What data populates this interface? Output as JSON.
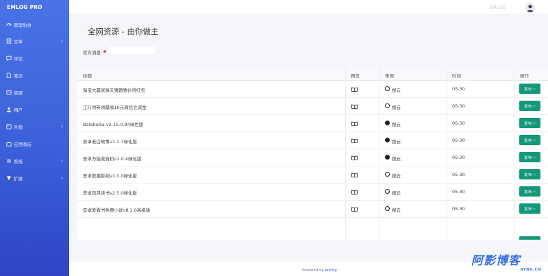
{
  "sidebar": {
    "brand": "EMLOG PRO",
    "items": [
      {
        "label": "管理后台",
        "icon": "dashboard-icon",
        "chevron": false
      },
      {
        "label": "文章",
        "icon": "article-icon",
        "chevron": true
      },
      {
        "label": "评论",
        "icon": "comment-icon",
        "chevron": false
      },
      {
        "label": "笔记",
        "icon": "note-icon",
        "chevron": false
      },
      {
        "label": "资源",
        "icon": "resource-icon",
        "chevron": false
      },
      {
        "label": "用户",
        "icon": "user-icon",
        "chevron": false
      },
      {
        "label": "外观",
        "icon": "appearance-icon",
        "chevron": true
      },
      {
        "label": "应用商店",
        "icon": "store-icon",
        "chevron": false
      },
      {
        "label": "系统",
        "icon": "gear-icon",
        "chevron": true
      },
      {
        "label": "扩展",
        "icon": "plugin-icon",
        "chevron": true
      }
    ]
  },
  "topbar": {
    "brand": "EMLOG"
  },
  "main": {
    "title": "全网资源 - 由你做主",
    "announce_label": "官方消息"
  },
  "table": {
    "headers": {
      "title": "标题",
      "preview": "预览",
      "source": "来源",
      "time": "时间",
      "action": "操作"
    },
    "rows": [
      {
        "title": "淘宝大赢家每天猜题猜价得红包",
        "source": "搜云",
        "time": "05-30",
        "action": "发布"
      },
      {
        "title": "工行领券领最高10元微信立减金",
        "source": "搜云",
        "time": "05-30",
        "action": "发布"
      },
      {
        "title": "Balabolka v2.15.0.84绿色版",
        "source": "搜云",
        "time": "05-30",
        "action": "发布"
      },
      {
        "title": "安卓老白故事v1.1.7绿化版",
        "source": "搜云",
        "time": "05-30",
        "action": "发布"
      },
      {
        "title": "安卓万能收音机v1.0.4绿化版",
        "source": "搜云",
        "time": "05-30",
        "action": "发布"
      },
      {
        "title": "安卓熊猫影视v1.0.0绿化版",
        "source": "搜云",
        "time": "05-30",
        "action": "发布"
      },
      {
        "title": "安卓风月读书v2.5.0绿化版",
        "source": "搜云",
        "time": "05-30",
        "action": "发布"
      },
      {
        "title": "安卓爱看书免费小说v8.1.0高级版",
        "source": "搜云",
        "time": "05-30",
        "action": "发布"
      }
    ]
  },
  "footer": {
    "powered_prefix": "Powered by",
    "powered_link": "emlog"
  },
  "watermark": {
    "main": "阿影博客",
    "sub": "AYBK.CN"
  },
  "colors": {
    "sidebar_top": "#4a73e8",
    "sidebar_bottom": "#2f45c4",
    "action_button": "#14987a",
    "notice_dot": "#e8572a"
  }
}
